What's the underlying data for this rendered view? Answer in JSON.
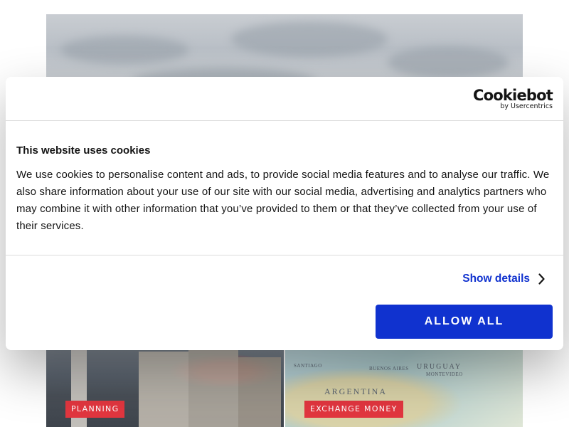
{
  "cookie_dialog": {
    "brand": {
      "logo_text": "Cookiebot",
      "logo_subtext": "by Usercentrics"
    },
    "title": "This website uses cookies",
    "body_text": "We use cookies to personalise content and ads, to provide social media features and to analyse our traffic. We also share information about your use of our site with our social media, advertising and analytics partners who may combine it with other information that you’ve provided to them or that they’ve collected from your use of their services.",
    "show_details_label": "Show details",
    "allow_all_label": "ALLOW ALL",
    "accent_color": "#1032cf",
    "icons": {
      "show_details": "chevron-right-icon"
    }
  },
  "background_page": {
    "cards": [
      {
        "tag": "PLANNING",
        "image": "city-street-photo"
      },
      {
        "tag": "EXCHANGE MONEY",
        "image": "south-america-map-photo",
        "map_labels": [
          "ARGENTINA",
          "URUGUAY",
          "BUENOS AIRES",
          "MONTEVIDEO",
          "SANTIAGO"
        ]
      }
    ],
    "tag_color": "#e2363f"
  }
}
